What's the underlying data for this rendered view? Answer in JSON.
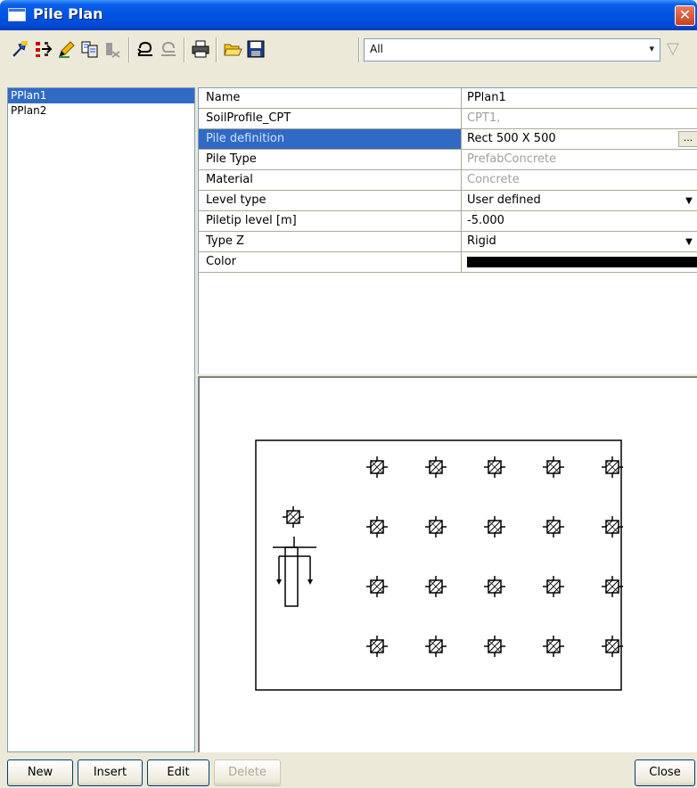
{
  "window": {
    "title": "Pile Plan",
    "close_glyph": "✕"
  },
  "toolbar": {
    "icons": [
      "select-pile-icon",
      "move-piles-icon",
      "edit-pencil-icon",
      "copy-props-icon",
      "delete-pile-icon",
      "undo-icon",
      "redo-icon",
      "print-icon",
      "open-folder-icon",
      "save-disk-icon"
    ],
    "filter": {
      "value": "All",
      "arrow": "▾",
      "funnel": "▽"
    }
  },
  "plans": {
    "items": [
      "PPlan1",
      "PPlan2"
    ],
    "selected": "PPlan1"
  },
  "properties": {
    "rows": [
      {
        "name": "Name",
        "value": "PPlan1",
        "kind": "text"
      },
      {
        "name": "SoilProfile_CPT",
        "value": "CPT1,",
        "kind": "grey"
      },
      {
        "name": "Pile definition",
        "value": "Rect 500 X 500",
        "kind": "ellipsis",
        "highlight": true,
        "button": "..."
      },
      {
        "name": "Pile Type",
        "value": "PrefabConcrete",
        "kind": "grey"
      },
      {
        "name": "Material",
        "value": "Concrete",
        "kind": "grey"
      },
      {
        "name": "Level type",
        "value": "User defined",
        "kind": "dropdown",
        "button": "▼"
      },
      {
        "name": "Piletip level [m]",
        "value": "-5.000",
        "kind": "text"
      },
      {
        "name": "Type Z",
        "value": "Rigid",
        "kind": "dropdown",
        "button": "▼"
      },
      {
        "name": "Color",
        "value": "",
        "kind": "color",
        "color": "#000000"
      }
    ]
  },
  "plan_view": {
    "pile_rows": 4,
    "pile_cols": 5,
    "extra_pile": true
  },
  "buttons": {
    "new": "New",
    "insert": "Insert",
    "edit": "Edit",
    "delete": "Delete",
    "close": "Close"
  }
}
